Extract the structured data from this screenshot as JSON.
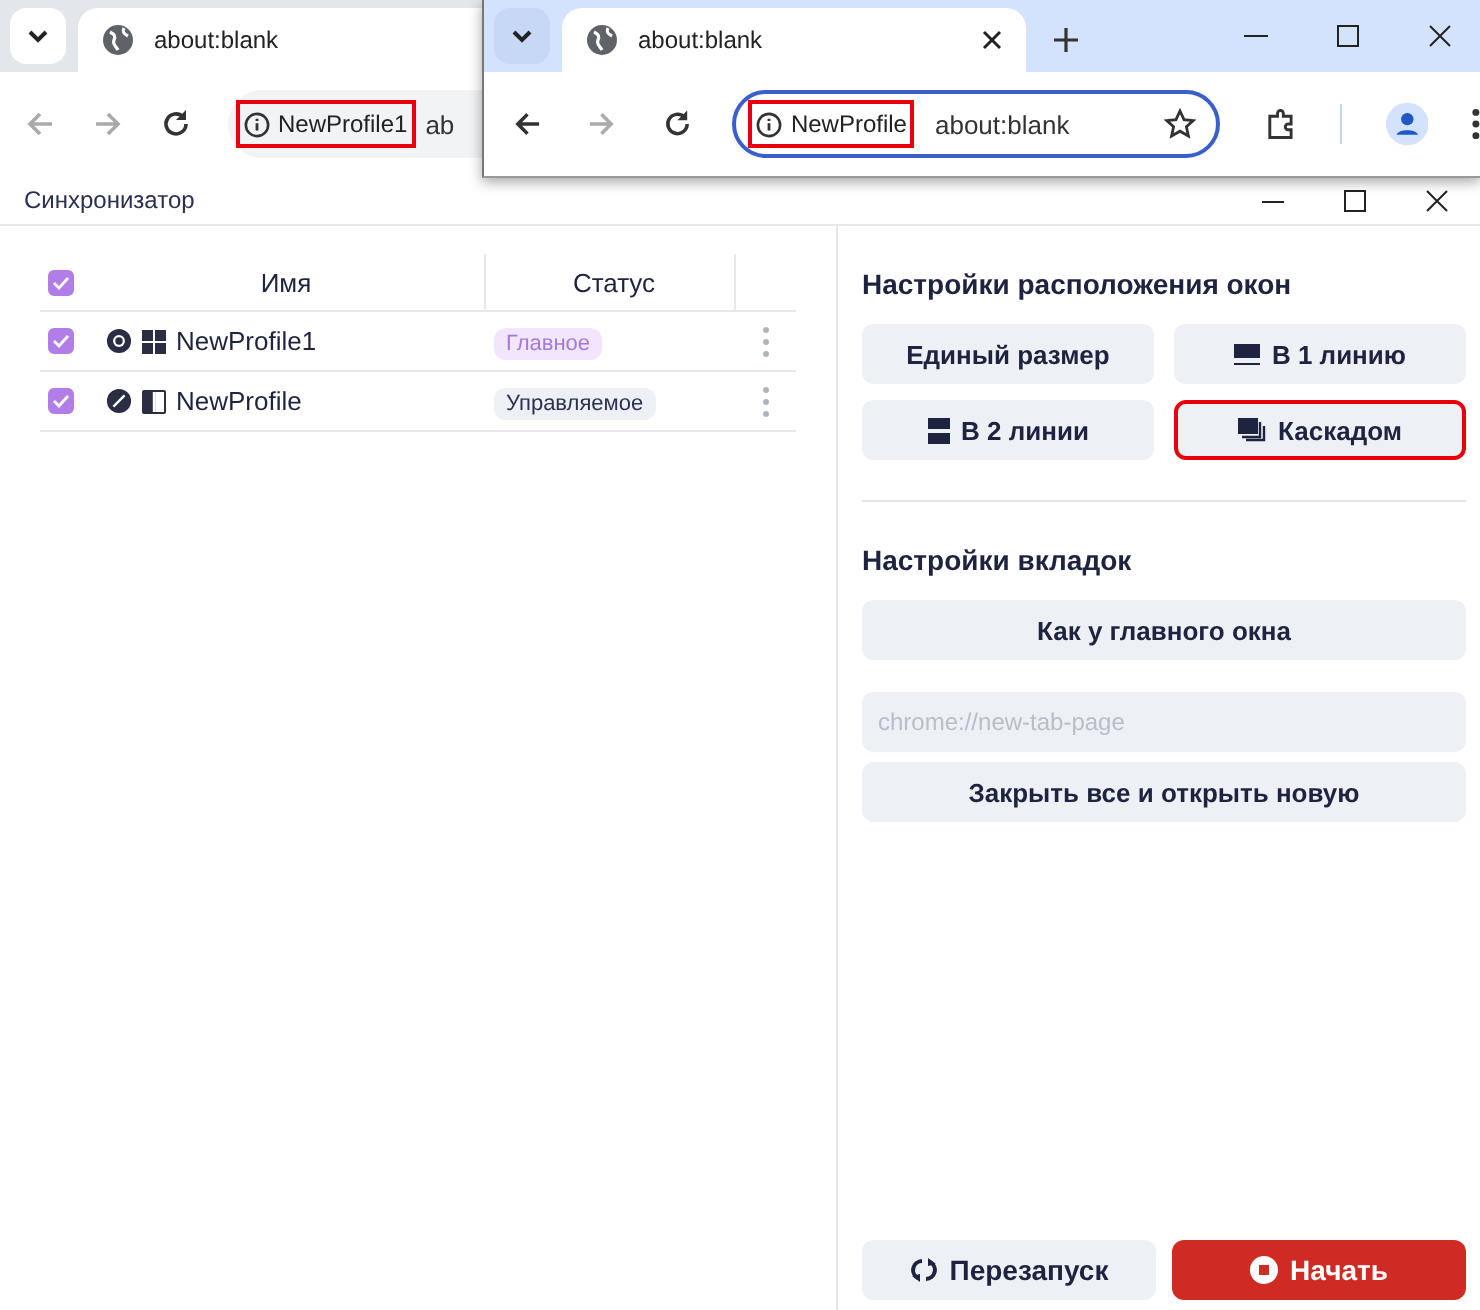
{
  "browser_windows": [
    {
      "tab_title": "about:blank",
      "profile_chip": "NewProfile1",
      "url": "ab",
      "highlighted": true,
      "back_enabled": false,
      "focused": false
    },
    {
      "tab_title": "about:blank",
      "profile_chip": "NewProfile",
      "url": "about:blank",
      "highlighted": true,
      "back_enabled": true,
      "focused": true
    }
  ],
  "app": {
    "title": "Синхронизатор",
    "table": {
      "header_checked": true,
      "columns": [
        "Имя",
        "Статус"
      ],
      "rows": [
        {
          "checked": true,
          "icons": [
            {
              "kind": "chrome"
            },
            {
              "kind": "windows"
            }
          ],
          "name": "NewProfile1",
          "status": {
            "text": "Главное",
            "kind": "main"
          }
        },
        {
          "checked": true,
          "icons": [
            {
              "kind": "compass"
            },
            {
              "kind": "mac"
            }
          ],
          "name": "NewProfile",
          "status": {
            "text": "Управляемое",
            "kind": "managed"
          }
        }
      ]
    },
    "layout_section": {
      "title": "Настройки расположения окон",
      "buttons": [
        {
          "label": "Единый размер",
          "kind": "plain",
          "highlighted": false
        },
        {
          "label": "В 1 линию",
          "kind": "one-line",
          "highlighted": false
        },
        {
          "label": "В 2 линии",
          "kind": "two-lines",
          "highlighted": false
        },
        {
          "label": "Каскадом",
          "kind": "cascade",
          "highlighted": true
        }
      ]
    },
    "tabs_section": {
      "title": "Настройки вкладок",
      "main_button": "Как у главного окна",
      "url_field": {
        "placeholder": "chrome://new-tab-page"
      },
      "close_button": "Закрыть все и открыть новую"
    },
    "footer": [
      {
        "label": "Перезапуск",
        "kind": "restart"
      },
      {
        "label": "Начать",
        "kind": "start"
      }
    ]
  }
}
